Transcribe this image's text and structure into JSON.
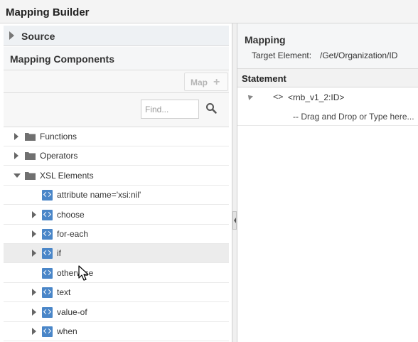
{
  "window": {
    "title": "Mapping Builder"
  },
  "left": {
    "source_label": "Source",
    "components_title": "Mapping Components",
    "map_button_label": "Map",
    "search_placeholder": "Find...",
    "tree": [
      {
        "label": "Functions",
        "kind": "folder",
        "expander": "collapsed"
      },
      {
        "label": "Operators",
        "kind": "folder",
        "expander": "collapsed"
      },
      {
        "label": "XSL Elements",
        "kind": "folder",
        "expander": "expanded"
      },
      {
        "label": "attribute name='xsi:nil'",
        "kind": "xsl",
        "expander": "none"
      },
      {
        "label": "choose",
        "kind": "xsl",
        "expander": "collapsed"
      },
      {
        "label": "for-each",
        "kind": "xsl",
        "expander": "collapsed"
      },
      {
        "label": "if",
        "kind": "xsl",
        "expander": "collapsed",
        "hovered": true
      },
      {
        "label": "otherwise",
        "kind": "xsl",
        "expander": "none"
      },
      {
        "label": "text",
        "kind": "xsl",
        "expander": "collapsed"
      },
      {
        "label": "value-of",
        "kind": "xsl",
        "expander": "collapsed"
      },
      {
        "label": "when",
        "kind": "xsl",
        "expander": "collapsed"
      }
    ]
  },
  "right": {
    "mapping_title": "Mapping",
    "target_label": "Target Element:",
    "target_value": "/Get/Organization/ID",
    "statement_header": "Statement",
    "statement_element": "<rnb_v1_2:ID>",
    "drag_hint": "-- Drag and Drop or Type here..."
  },
  "colors": {
    "xsl_icon": "#4a86c8",
    "folder_icon": "#707070",
    "hover_row": "#ececec"
  }
}
